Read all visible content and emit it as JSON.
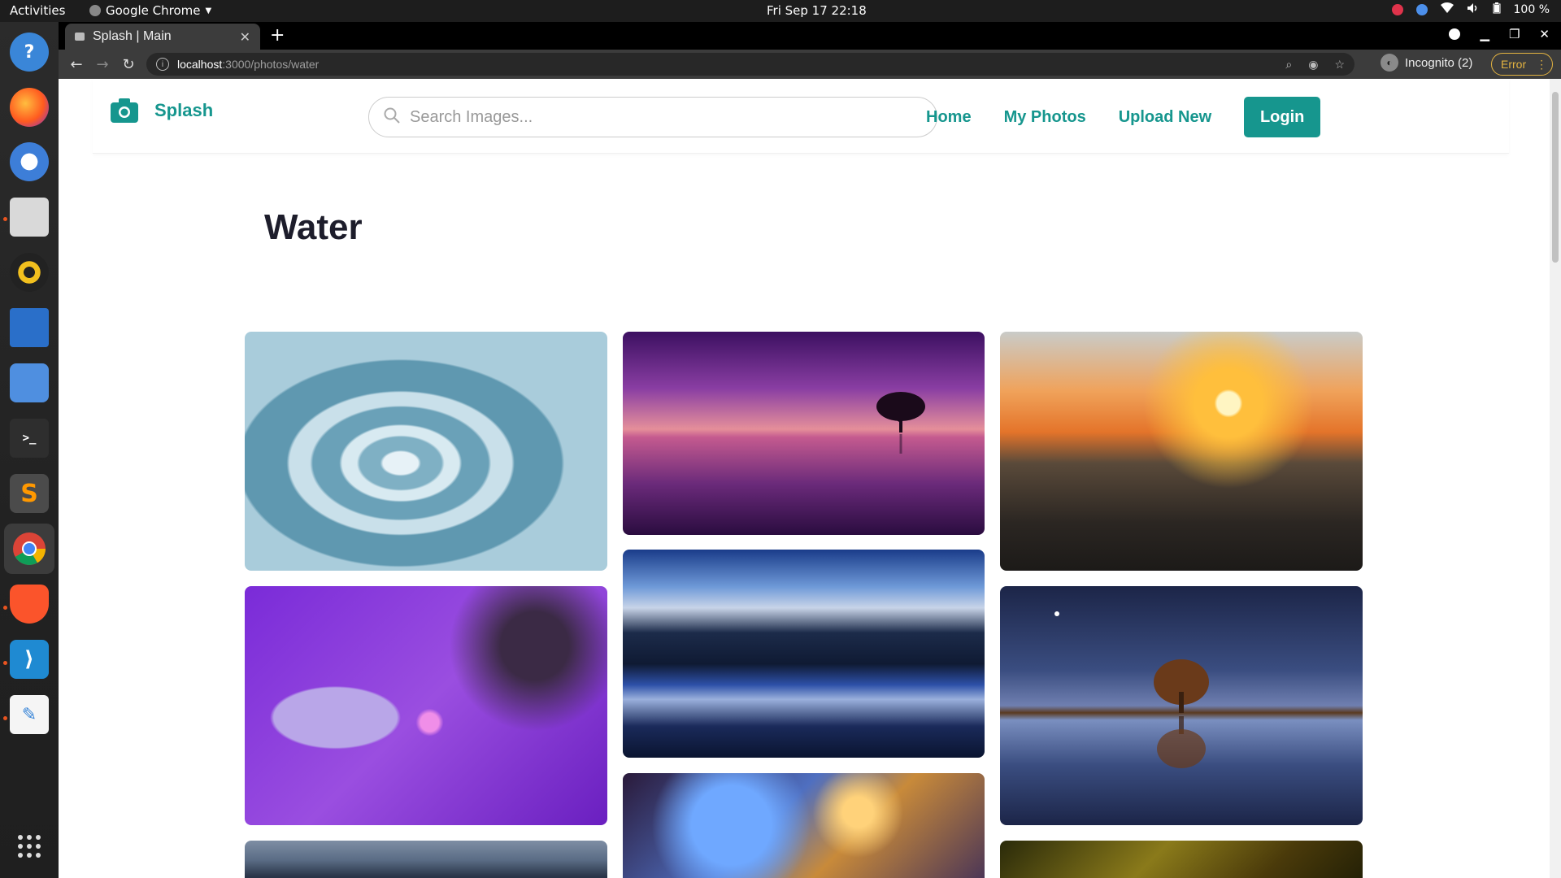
{
  "system_bar": {
    "activities": "Activities",
    "app_name": "Google Chrome",
    "clock": "Fri Sep 17  22:18",
    "battery": "100 %"
  },
  "browser": {
    "tab_title": "Splash | Main",
    "url_host": "localhost",
    "url_path": ":3000/photos/water",
    "profile_label": "Incognito (2)",
    "error_label": "Error"
  },
  "site": {
    "brand": "Splash",
    "search_placeholder": "Search Images...",
    "nav": {
      "home": "Home",
      "my_photos": "My Photos",
      "upload_new": "Upload New",
      "login": "Login"
    },
    "page_title": "Water"
  },
  "colors": {
    "accent": "#16968e",
    "title": "#1d1d2b"
  },
  "photos": [
    {
      "subject": "water drop ripple",
      "palette": "#8fb8c9"
    },
    {
      "subject": "purple sunset lone tree reflection",
      "palette": "#9b4fa5"
    },
    {
      "subject": "ocean wave at sunset",
      "palette": "#d98a3c"
    },
    {
      "subject": "purple water lily",
      "palette": "#8a2fd1"
    },
    {
      "subject": "snowy mountains lake reflection",
      "palette": "#1f3f8a"
    },
    {
      "subject": "night tree reflection",
      "palette": "#2b3a6a"
    },
    {
      "subject": "sea horizon",
      "palette": "#5c6b80"
    },
    {
      "subject": "colorful clouds",
      "palette": "#3b6fc2"
    },
    {
      "subject": "autumn forest",
      "palette": "#6b5a1a"
    }
  ]
}
